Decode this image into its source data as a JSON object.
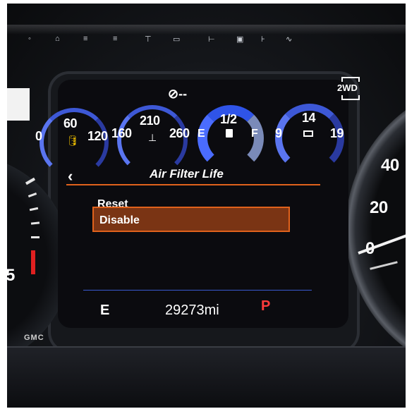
{
  "top_indicator": {
    "symbol": "⊘",
    "value": "--"
  },
  "drive_mode": {
    "top": "2WD"
  },
  "gauges": {
    "oil_pressure": {
      "low": "0",
      "mid": "60",
      "high": "120",
      "icon": "oil-can-icon"
    },
    "coolant_temp": {
      "low": "160",
      "mid": "210",
      "high": "260",
      "icon": "thermometer-icon"
    },
    "fuel": {
      "low": "E",
      "mid": "1/2",
      "high": "F",
      "icon": "fuel-pump-icon"
    },
    "battery": {
      "low": "9",
      "mid": "14",
      "high": "19",
      "icon": "battery-icon"
    }
  },
  "menu": {
    "back_symbol": "‹",
    "title": "Air Filter Life",
    "items": [
      {
        "label": "Reset",
        "selected": false
      },
      {
        "label": "Disable",
        "selected": true
      }
    ]
  },
  "status_bar": {
    "fuel_economy_mode": "E",
    "odometer": "29273mi",
    "gear": "P"
  },
  "speedometer": {
    "mark_40": "40",
    "mark_20": "20",
    "mark_0": "0"
  },
  "tachometer": {
    "partial_mark": "5"
  },
  "brand": {
    "logo": "GMC"
  },
  "colors": {
    "accent_orange": "#e0621c",
    "selection_fill": "#7a3414",
    "gauge_blue": "#3d58d6",
    "gear_red": "#ff3b3b",
    "screen_bg": "#0c0c10"
  }
}
